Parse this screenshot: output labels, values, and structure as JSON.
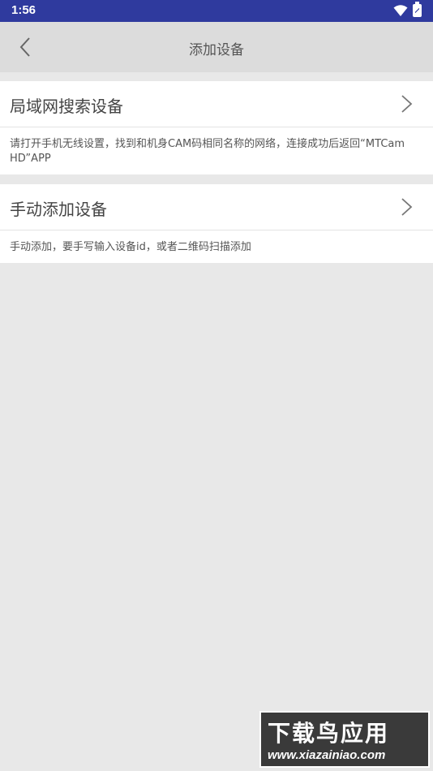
{
  "statusbar": {
    "time": "1:56",
    "icons": [
      "wifi-icon",
      "battery-icon"
    ]
  },
  "appbar": {
    "title": "添加设备",
    "back_icon": "chevron-left-icon"
  },
  "cards": [
    {
      "title": "局域网搜索设备",
      "description": "请打开手机无线设置，找到和机身CAM码相同名称的网络，连接成功后返回“MTCam HD”APP"
    },
    {
      "title": "手动添加设备",
      "description": "手动添加，要手写输入设备id，或者二维码扫描添加"
    }
  ],
  "watermark": {
    "line1": "下载鸟应用",
    "line2": "www.xiazainiao.com"
  },
  "colors": {
    "statusbar": "#2f3a9e",
    "appbar": "#dcdcdc",
    "background": "#e8e8e8",
    "card": "#ffffff"
  }
}
